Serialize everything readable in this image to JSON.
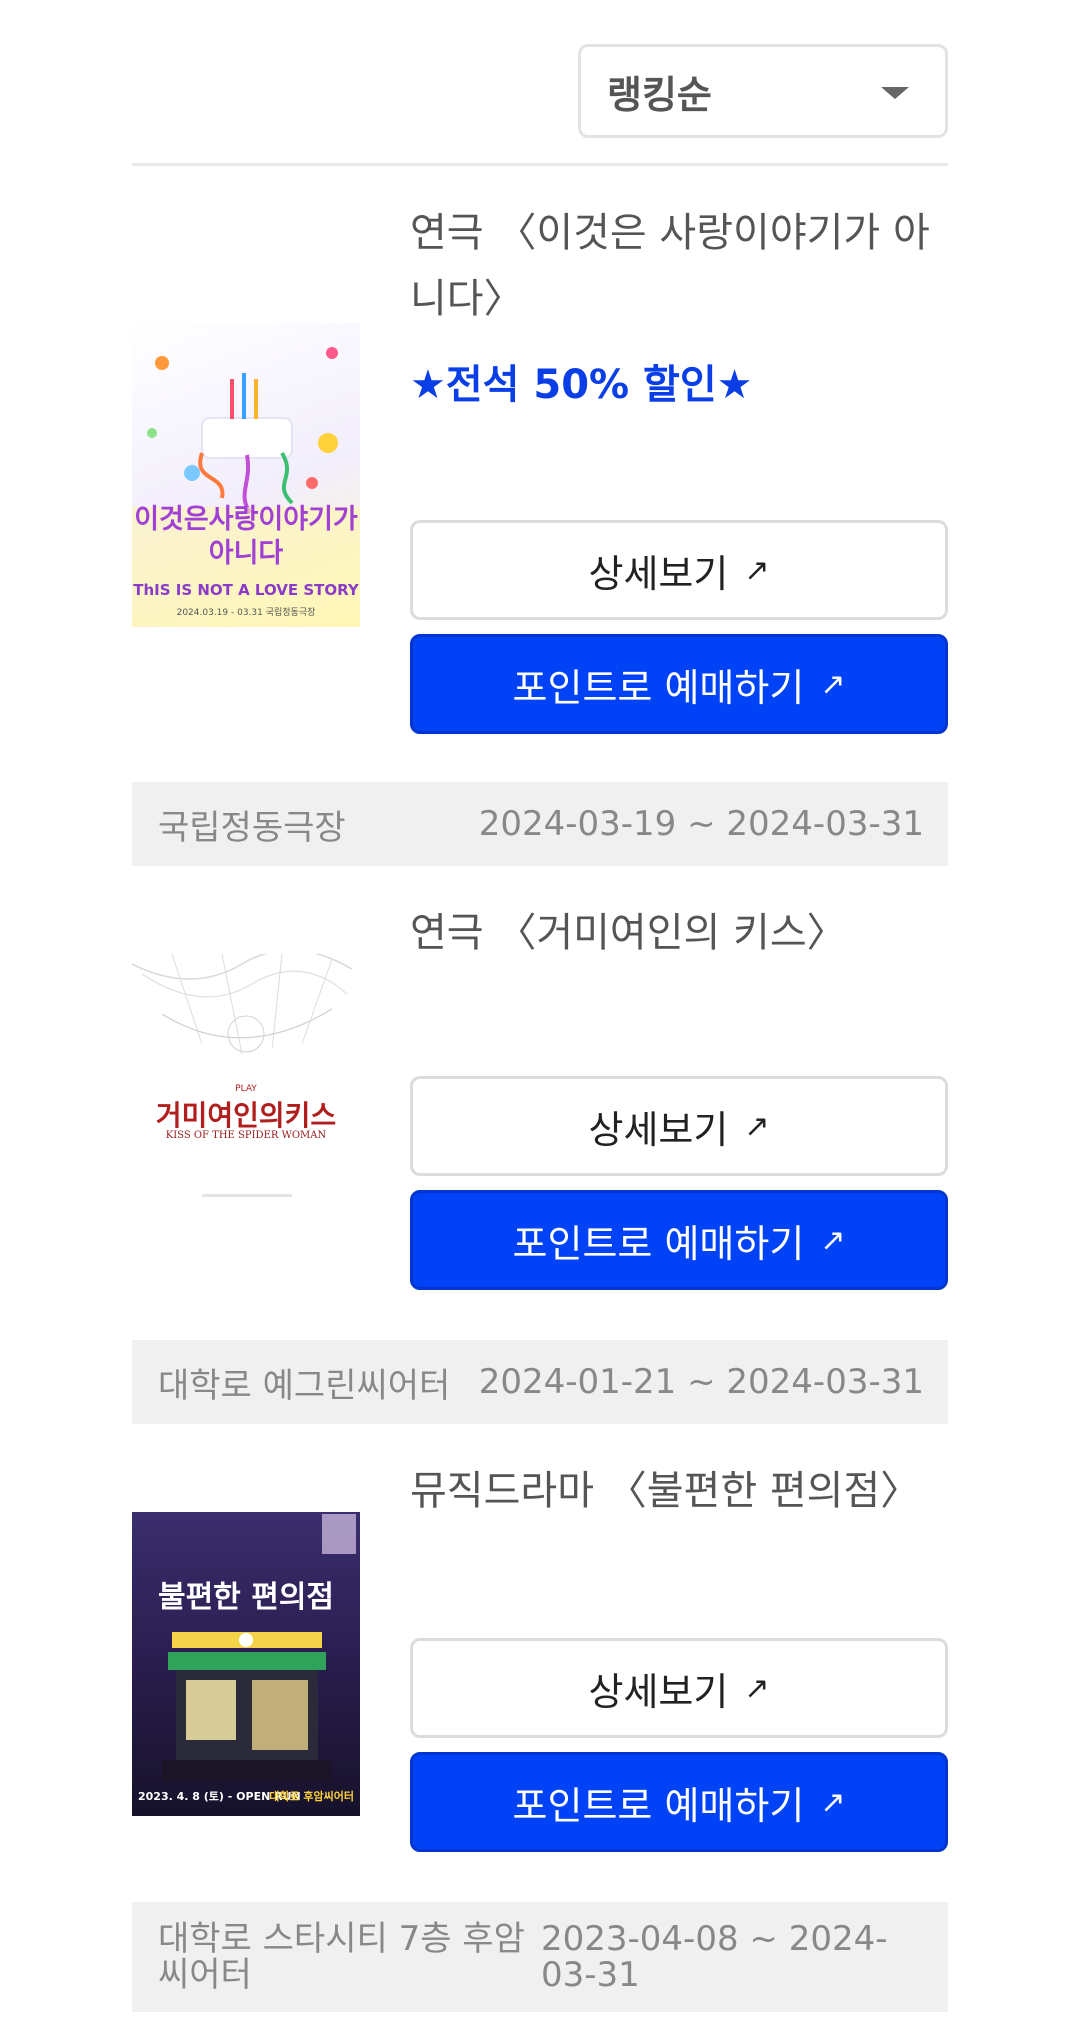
{
  "sort": {
    "label": "랭킹순"
  },
  "items": [
    {
      "title": "연극 〈이것은 사랑이야기가 아니다〉",
      "promo": "★전석 50% 할인★",
      "detail_label": "상세보기",
      "book_label": "포인트로 예매하기",
      "venue": "국립정동극장",
      "dates": "2024-03-19 ~ 2024-03-31",
      "poster": {
        "title_text": "이것은사랑이야기가아니다",
        "subtitle": "ThIS IS NOT A LOVE STORY",
        "date_text": "2024.03.19 - 03.31 국립정동극장"
      }
    },
    {
      "title": "연극 〈거미여인의 키스〉",
      "promo": "",
      "detail_label": "상세보기",
      "book_label": "포인트로 예매하기",
      "venue": "대학로 예그린씨어터",
      "dates": "2024-01-21 ~ 2024-03-31",
      "poster": {
        "play": "PLAY",
        "title_text": "거미여인의키스",
        "subtitle": "KISS OF THE SPIDER WOMAN"
      }
    },
    {
      "title": "뮤직드라마 〈불편한 편의점〉",
      "promo": "",
      "detail_label": "상세보기",
      "book_label": "포인트로 예매하기",
      "venue": "대학로 스타시티 7층 후암씨어터",
      "dates": "2023-04-08 ~ 2024-03-31",
      "poster": {
        "title_text": "불편한 편의점",
        "bottom_left": "2023. 4. 8 (토) - OPEN RUN",
        "bottom_right": "대학로 후암씨어터"
      }
    }
  ],
  "colors": {
    "accent": "#0042f5",
    "promo": "#0a3ee6",
    "info_bg": "#f0f0f0"
  },
  "icons": {
    "sort_caret": "caret-down-icon",
    "external": "arrow-up-right-icon"
  }
}
